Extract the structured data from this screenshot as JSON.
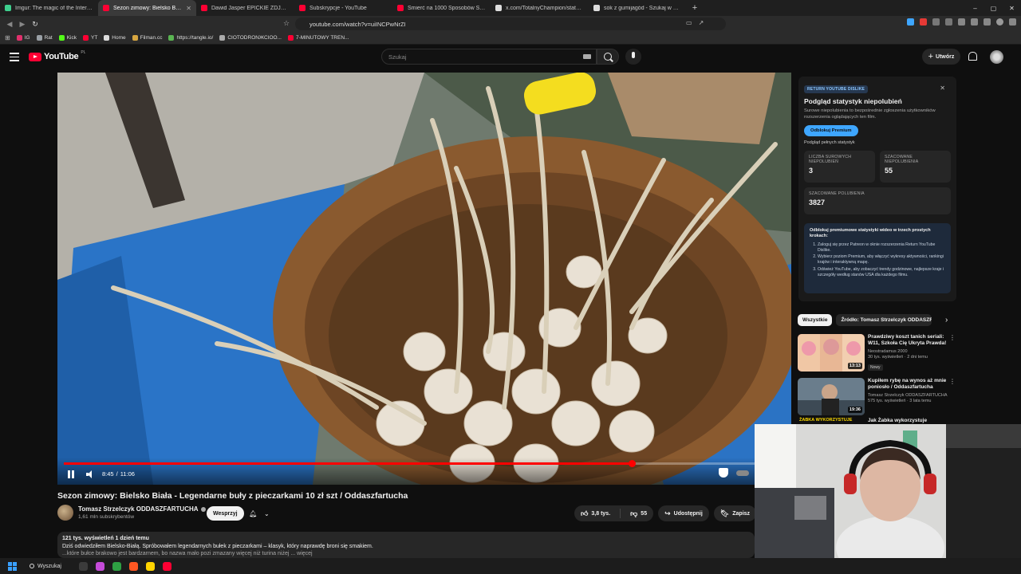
{
  "browser": {
    "tabs": [
      {
        "label": "Imgur: The magic of the Internet",
        "color": "#3ecf8e",
        "active": false
      },
      {
        "label": "Sezon zimowy: Bielsko Biała",
        "color": "#ff0033",
        "active": true
      },
      {
        "label": "Dawid Jasper EPICKIE ZDJĘCIA AI - Y",
        "color": "#ff0033",
        "active": false
      },
      {
        "label": "Subskrypcje - YouTube",
        "color": "#ff0033",
        "active": false
      },
      {
        "label": "Śmierć na 1000 Sposobów Sezon 3",
        "color": "#ff0033",
        "active": false
      },
      {
        "label": "x.com/TotalnyChampion/status/2007",
        "color": "#dddddd",
        "active": false
      },
      {
        "label": "sok z gumijagód - Szukaj w Google",
        "color": "#dddddd",
        "active": false
      }
    ],
    "url": "youtube.com/watch?v=uiINCPwNrZI",
    "bookmarks": [
      {
        "label": "IG",
        "color": "#e1306c"
      },
      {
        "label": "Rat",
        "color": "#9aa0a6"
      },
      {
        "label": "Kick",
        "color": "#53fc18"
      },
      {
        "label": "YT",
        "color": "#ff0033"
      },
      {
        "label": "Home",
        "color": "#dddddd"
      },
      {
        "label": "Filman.cc",
        "color": "#d7a640"
      },
      {
        "label": "https://tangle.io/",
        "color": "#5ab552"
      },
      {
        "label": "CIOTODRONЖCIOO...",
        "color": "#aaaaaa"
      },
      {
        "label": "7-MINUTOWY TREN...",
        "color": "#ff0033"
      }
    ],
    "window_controls": [
      "–",
      "▢",
      "✕"
    ]
  },
  "youtube": {
    "logo_text": "YouTube",
    "logo_country": "PL",
    "search_placeholder": "Szukaj",
    "create_label": "Utwórz"
  },
  "player": {
    "current_time": "8:45",
    "separator": "/",
    "duration": "11:06",
    "progress_fraction": 0.788
  },
  "video": {
    "title": "Sezon zimowy: Bielsko Biała - Legendarne buły z pieczarkami 10 zł szt / Oddaszfartucha",
    "channel_name": "Tomasz Strzelczyk ODDASZFARTUCHA",
    "subscribers": "1,61 mln subskrybentów",
    "support_label": "Wesprzyj",
    "likes": "3,8 tys.",
    "dislikes": "55",
    "share_label": "Udostępnij",
    "save_label": "Zapisz",
    "views_line": "121 tys. wyświetleń  1 dzień temu",
    "description_line1": "Dziś odwiedziłem Bielsko-Białą. Spróbowałem legendarnych bułek z pieczarkami – klasyk, który naprawdę broni się smakiem.",
    "description_line2": "...które bułce brakowo jest bardzarnem, bo nazwa mało pozi zmazany więcej niż turina niżej ... więcej"
  },
  "ryd": {
    "badge": "RETURN YOUTUBE DISLIKE",
    "title": "Podgląd statystyk niepolubień",
    "subtitle": "Surowe niepolubienia to bezpośrednie zgłoszenia użytkowników rozszerzenia oglądających ten film.",
    "unlock_label": "Odblokuj Premium",
    "full_stats_link": "Podgląd pełnych statystyk",
    "raw_label": "Liczba surowych niepolubień",
    "raw_value": "3",
    "est_dislike_label": "Szacowane niepolubienia",
    "est_dislike_value": "55",
    "est_like_label": "Szacowane polubienia",
    "est_like_value": "3827",
    "promo_heading": "Odblokuj premiumowe statystyki wideo w trzech prostych krokach:",
    "promo_steps": [
      "Zaloguj się przez Patreon w oknie rozszerzenia Return YouTube Dislike.",
      "Wybierz poziom Premium, aby włączyć wykresy aktywności, rankingi krajów i interaktywną mapę.",
      "Odśwież YouTube, aby zobaczyć trendy godzinowe, najlepsze kraje i szczegóły według stanów USA dla każdego filmu."
    ]
  },
  "chips": {
    "all": "Wszystkie",
    "source": "Źródło: Tomasz Strzelczyk ODDASZFARTUCHA"
  },
  "recommendations": [
    {
      "title": "Prawdziwy koszt tanich seriali: W11, Szkoła Cię Ukryta Prawda!",
      "channel": "Neostradamus 2000",
      "views": "30 tys. wyświetleń · 2 dni temu",
      "badge": "Nowy",
      "duration": "13:13"
    },
    {
      "title": "Kupiłem rybę na wynos aż mnie poniosło / Oddaszfartucha",
      "channel": "Tomasz Strzelczyk ODDASZFARTUCHA",
      "views": "575 tys. wyświetleń · 3 lata temu",
      "badge": "",
      "duration": "19:36"
    },
    {
      "title": "Jak Żabka wykorzystuje",
      "thumb_text": "ŻABKA WYKORZYSTUJE"
    }
  ],
  "taskbar": {
    "search_label": "Wyszukaj",
    "app_colors": [
      "#3b3b3b",
      "#c54bd9",
      "#2ea043",
      "#ff5722",
      "#ffd400",
      "#ff0033"
    ]
  },
  "colors": {
    "youtube_red": "#ff0033",
    "background": "#0f0f0f",
    "ryd_accent": "#3ea6ff"
  }
}
